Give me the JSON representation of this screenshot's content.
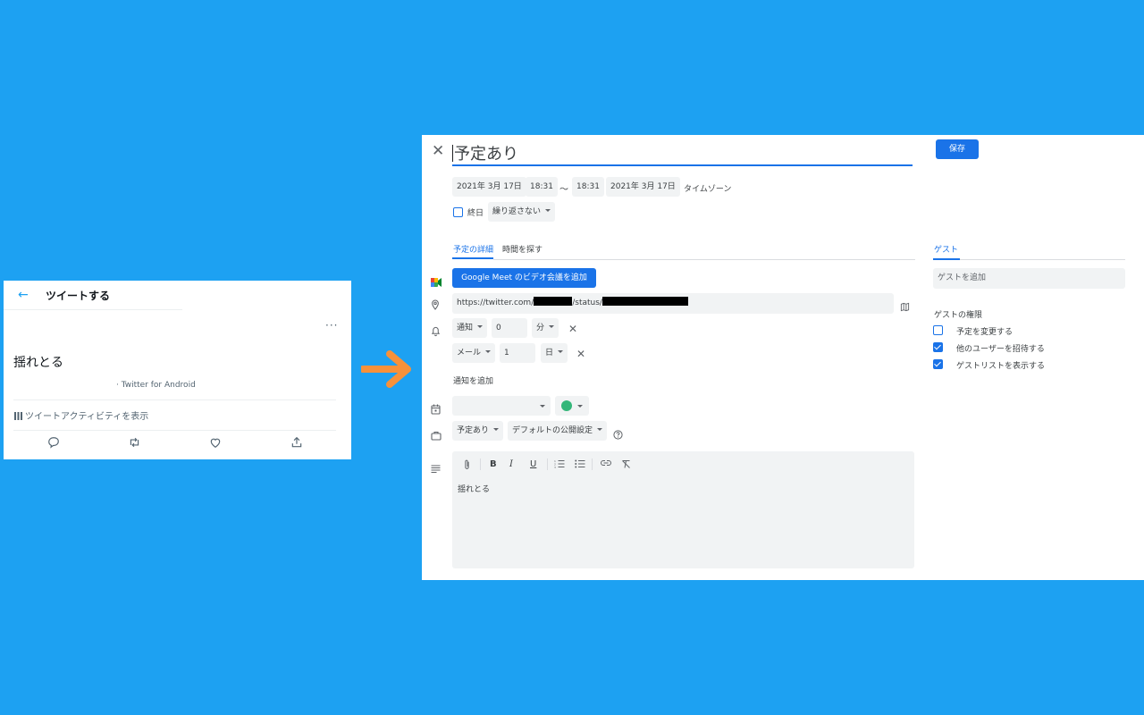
{
  "twitter": {
    "back_icon": "arrow-left-icon",
    "title": "ツイートする",
    "more": "···",
    "text": "揺れとる",
    "source": "· Twitter for Android",
    "activity": "ツイートアクティビティを表示",
    "accent": "#1DA1F2",
    "actions": [
      "reply-icon",
      "retweet-icon",
      "like-icon",
      "share-icon"
    ]
  },
  "arrow": {
    "color": "#F7913A",
    "icon": "arrow-right-icon"
  },
  "calendar": {
    "close_icon": "close-icon",
    "title": "予定あり",
    "save": "保存",
    "start_date": "2021年 3月 17日",
    "start_time": "18:31",
    "tilde": "〜",
    "end_time": "18:31",
    "end_date": "2021年 3月 17日",
    "timezone": "タイムゾーン",
    "allday": "終日",
    "repeat": "繰り返さない",
    "tab_details": "予定の詳細",
    "tab_find_time": "時間を探す",
    "tab_guests": "ゲスト",
    "meet_button": "Google Meet のビデオ会議を追加",
    "location_prefix": "https://twitter.com/",
    "location_mid": "/status/",
    "notif1": {
      "type": "通知",
      "value": "0",
      "unit": "分"
    },
    "notif2": {
      "type": "メール",
      "value": "1",
      "unit": "日"
    },
    "add_notification": "通知を追加",
    "calendar_select": "",
    "color": "#33b679",
    "busy": "予定あり",
    "visibility": "デフォルトの公開設定",
    "description": "揺れとる",
    "guest_placeholder": "ゲストを追加",
    "guest_permissions_title": "ゲストの権限",
    "permissions": [
      {
        "label": "予定を変更する",
        "checked": false
      },
      {
        "label": "他のユーザーを招待する",
        "checked": true
      },
      {
        "label": "ゲストリストを表示する",
        "checked": true
      }
    ],
    "accent": "#1a73e8"
  }
}
